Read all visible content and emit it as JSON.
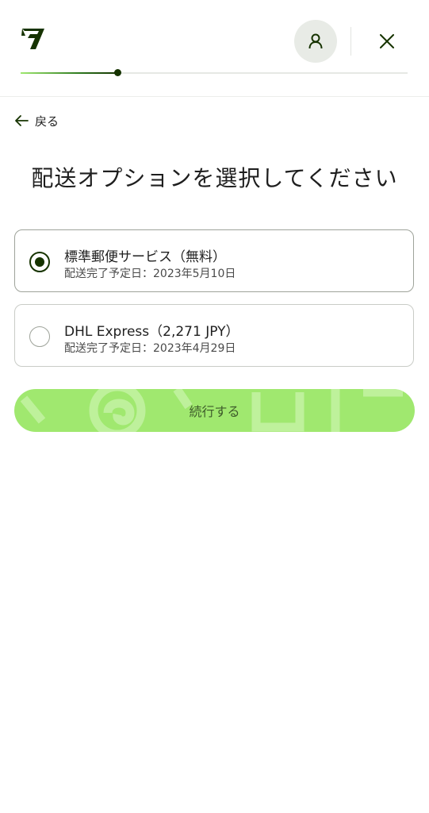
{
  "header": {
    "logo": "wise-logo",
    "account_icon": "user-icon",
    "close_icon": "close-icon",
    "progress": 0.25
  },
  "back": {
    "label": "戻る",
    "icon": "arrow-left-icon"
  },
  "title": "配送オプションを選択してください",
  "options": [
    {
      "name": "標準郵便サービス（無料）",
      "date": "配送完了予定日：2023年5月10日",
      "selected": true
    },
    {
      "name": "DHL Express（2,271 JPY）",
      "date": "配送完了予定日：2023年4月29日",
      "selected": false
    }
  ],
  "continue_label": "続行する",
  "colors": {
    "brand_dark": "#163300",
    "brand_green": "#9fe870",
    "border": "#c9ccc7"
  }
}
